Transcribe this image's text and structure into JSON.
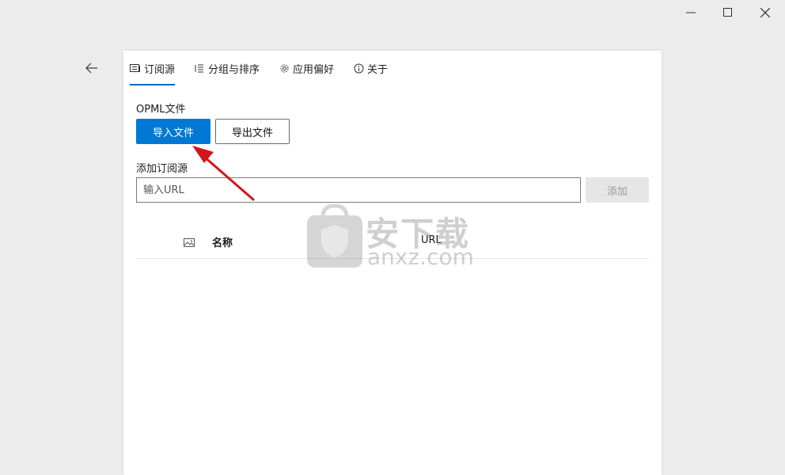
{
  "window_controls": {
    "minimize": "minimize",
    "maximize": "maximize",
    "close": "close"
  },
  "tabs": [
    {
      "label": "订阅源",
      "icon": "feed-icon",
      "active": true
    },
    {
      "label": "分组与排序",
      "icon": "list-icon",
      "active": false
    },
    {
      "label": "应用偏好",
      "icon": "gear-icon",
      "active": false
    },
    {
      "label": "关于",
      "icon": "info-icon",
      "active": false
    }
  ],
  "opml": {
    "label": "OPML文件",
    "import_label": "导入文件",
    "export_label": "导出文件"
  },
  "add_feed": {
    "label": "添加订阅源",
    "placeholder": "输入URL",
    "button_label": "添加"
  },
  "table": {
    "columns": [
      "名称",
      "URL"
    ]
  },
  "watermark": {
    "cn": "安下载",
    "en": "anxz.com"
  },
  "colors": {
    "accent": "#0078d4",
    "annotation_arrow": "#d0161b",
    "background": "#ececec"
  }
}
